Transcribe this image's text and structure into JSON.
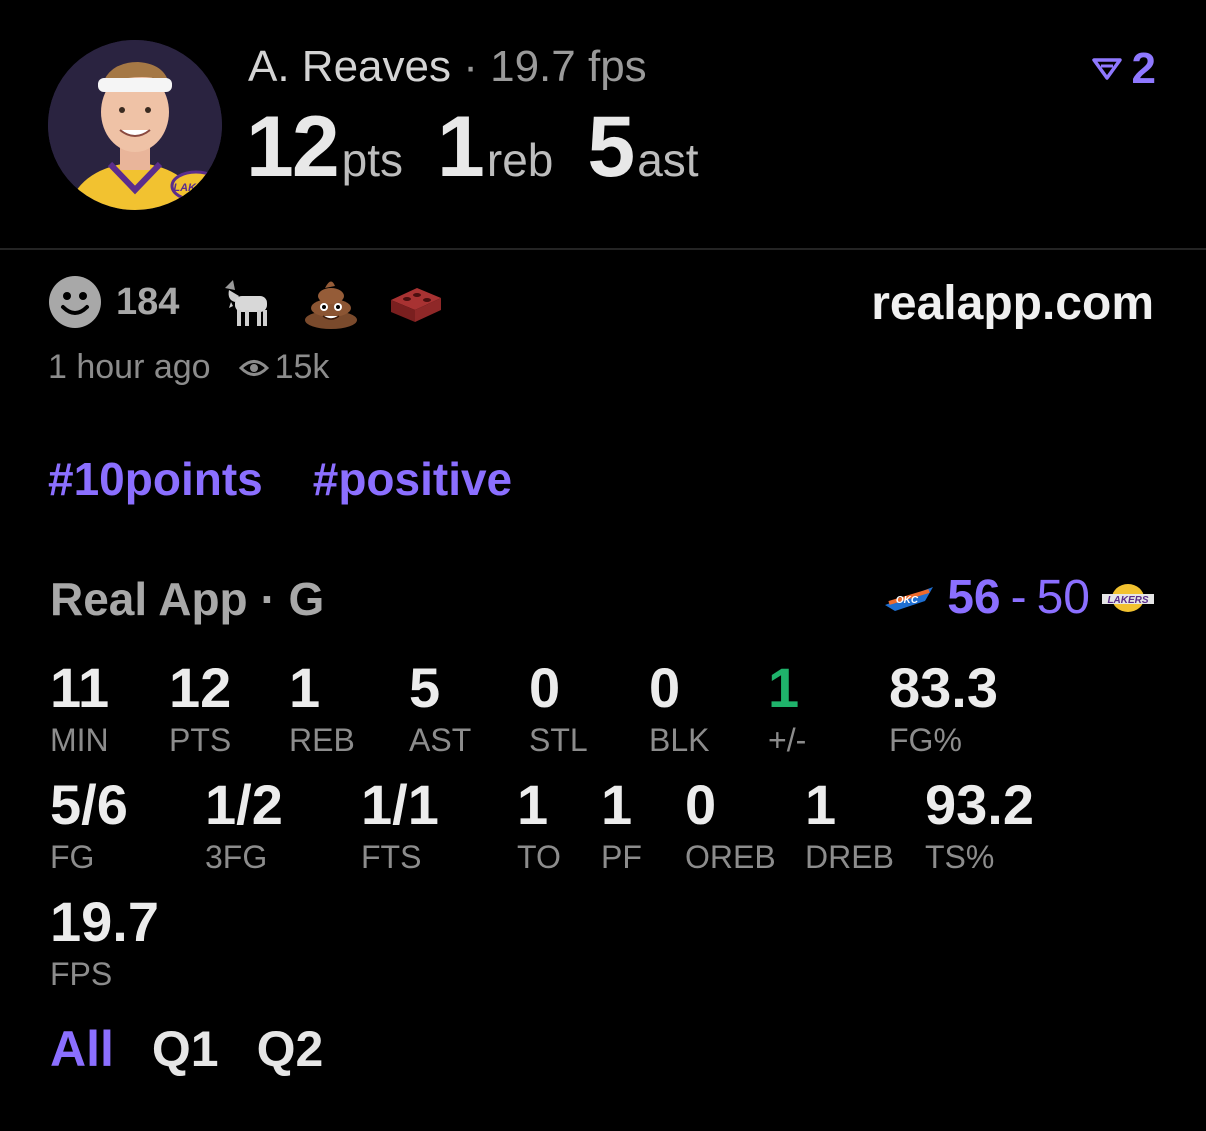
{
  "header": {
    "player_name": "A. Reaves",
    "separator": "·",
    "fps_text": "19.7 fps",
    "pts": "12",
    "pts_unit": "pts",
    "reb": "1",
    "reb_unit": "reb",
    "ast": "5",
    "ast_unit": "ast",
    "rank_value": "2",
    "rank_icon": "rank-chevron-icon"
  },
  "reactions": {
    "smiley_count": "184",
    "emojis": [
      "goat-icon",
      "poop-icon",
      "brick-icon"
    ],
    "site": "realapp.com",
    "time_ago": "1 hour ago",
    "views": "15k"
  },
  "tags": [
    "#10points",
    "#positive"
  ],
  "game": {
    "source": "Real App",
    "separator": "·",
    "position": "G",
    "home_team": "OKC",
    "away_team": "Lakers",
    "home_score": "56",
    "dash": "-",
    "away_score": "50"
  },
  "stats_row1": [
    {
      "value": "11",
      "label": "MIN"
    },
    {
      "value": "12",
      "label": "PTS"
    },
    {
      "value": "1",
      "label": "REB"
    },
    {
      "value": "5",
      "label": "AST"
    },
    {
      "value": "0",
      "label": "STL"
    },
    {
      "value": "0",
      "label": "BLK"
    },
    {
      "value": "1",
      "label": "+/-"
    },
    {
      "value": "83.3",
      "label": "FG%"
    }
  ],
  "stats_row2": [
    {
      "value": "5/6",
      "label": "FG"
    },
    {
      "value": "1/2",
      "label": "3FG"
    },
    {
      "value": "1/1",
      "label": "FTS"
    },
    {
      "value": "1",
      "label": "TO"
    },
    {
      "value": "1",
      "label": "PF"
    },
    {
      "value": "0",
      "label": "OREB"
    },
    {
      "value": "1",
      "label": "DREB"
    },
    {
      "value": "93.2",
      "label": "TS%"
    }
  ],
  "stats_row3": [
    {
      "value": "19.7",
      "label": "FPS"
    }
  ],
  "filters": [
    "All",
    "Q1",
    "Q2"
  ],
  "colors": {
    "accent": "#8b6fff",
    "positive": "#1fb36b",
    "background": "#000000"
  }
}
